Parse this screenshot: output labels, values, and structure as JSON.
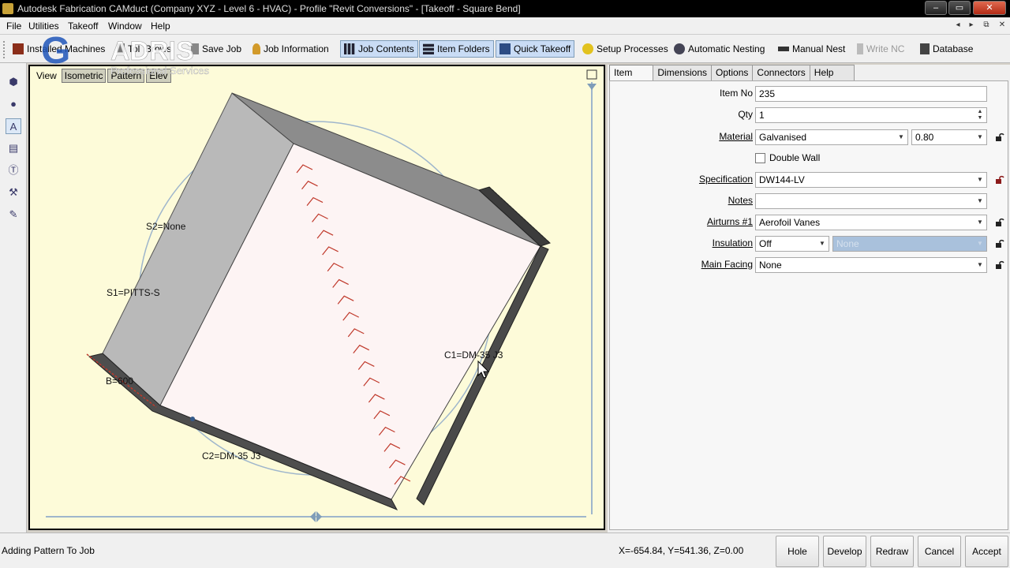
{
  "window": {
    "title": "Autodesk Fabrication CAMduct (Company XYZ - Level 6 - HVAC) - Profile \"Revit Conversions\" - [Takeoff - Square Bend]",
    "controls": [
      "–",
      "▭",
      "✕"
    ]
  },
  "menu": {
    "items": [
      "File",
      "Utilities",
      "Takeoff",
      "Window",
      "Help"
    ],
    "mdi_controls": [
      "◂",
      "▸",
      "⧉",
      "✕"
    ]
  },
  "toolbar": {
    "items": [
      {
        "label": "Installed Machines",
        "icon": "machines-icon"
      },
      {
        "label": "Tol",
        "icon": "tool-icon"
      },
      {
        "label": "Brows",
        "icon": "browse-icon"
      },
      {
        "label": "Save Job",
        "icon": "save-job-icon"
      },
      {
        "label": "Job Information",
        "icon": "job-info-icon"
      },
      {
        "label": "Job Contents",
        "icon": "job-contents-icon"
      },
      {
        "label": "Item Folders",
        "icon": "item-folders-icon"
      },
      {
        "label": "Quick Takeoff",
        "icon": "quick-takeoff-icon"
      },
      {
        "label": "Setup Processes",
        "icon": "setup-processes-icon"
      },
      {
        "label": "Automatic Nesting",
        "icon": "auto-nesting-icon"
      },
      {
        "label": "Manual Nest",
        "icon": "manual-nest-icon"
      },
      {
        "label": "Write NC",
        "icon": "write-nc-icon"
      },
      {
        "label": "Database",
        "icon": "database-icon"
      }
    ]
  },
  "watermark": {
    "brand": "ADRIS",
    "tag": "Professional Services"
  },
  "viewport": {
    "tabs": [
      "View",
      "Isometric",
      "Pattern",
      "Elev"
    ],
    "labels": {
      "s2": "S2=None",
      "s1": "S1=PITTS-S",
      "b": "B=600",
      "c1": "C1=DM-35 J3",
      "c2": "C2=DM-35 J3"
    }
  },
  "panel": {
    "tabs": [
      "Item",
      "Dimensions",
      "Options",
      "Connectors",
      "Help"
    ],
    "fields": {
      "item_no": {
        "label": "Item No",
        "value": "235"
      },
      "qty": {
        "label": "Qty",
        "value": "1"
      },
      "material": {
        "label": "Material",
        "value": "Galvanised",
        "gauge": "0.80"
      },
      "double_wall": {
        "label": "Double Wall"
      },
      "specification": {
        "label": "Specification",
        "value": "DW144-LV"
      },
      "notes": {
        "label": "Notes",
        "value": ""
      },
      "airturns": {
        "label": "Airturns #1",
        "value": "Aerofoil Vanes"
      },
      "insulation": {
        "label": "Insulation",
        "value": "Off",
        "type": "None"
      },
      "main_facing": {
        "label": "Main Facing",
        "value": "None"
      }
    }
  },
  "status": {
    "message": "Adding Pattern To Job",
    "coords": "X=-654.84, Y=541.36, Z=0.00",
    "buttons": [
      "Hole",
      "Develop",
      "Redraw",
      "Cancel",
      "Accept"
    ]
  }
}
